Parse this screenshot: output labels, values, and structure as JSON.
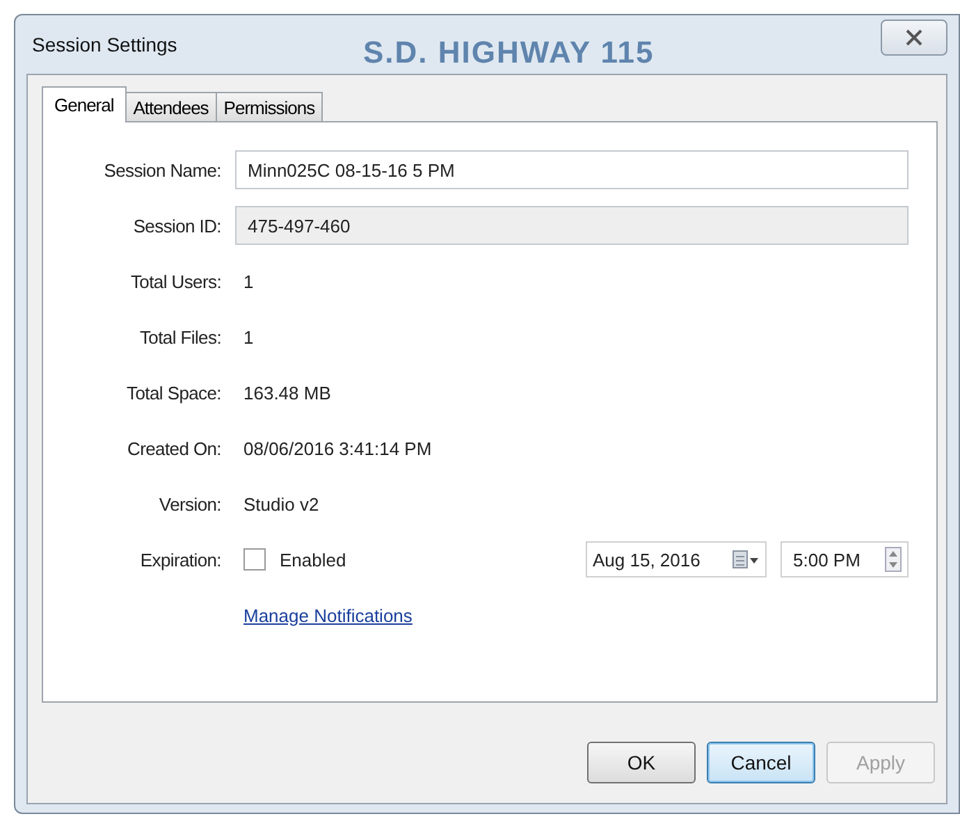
{
  "window": {
    "title": "Session Settings",
    "background_text": "S.D. HIGHWAY 115"
  },
  "tabs": [
    {
      "label": "General",
      "selected": true
    },
    {
      "label": "Attendees",
      "selected": false
    },
    {
      "label": "Permissions",
      "selected": false
    }
  ],
  "fields": [
    {
      "label": "Session Name:",
      "value": "Minn025C 08-15-16 5 PM",
      "kind": "input"
    },
    {
      "label": "Session ID:",
      "value": "475-497-460",
      "kind": "readonly"
    },
    {
      "label": "Total Users:",
      "value": "1",
      "kind": "text"
    },
    {
      "label": "Total Files:",
      "value": "1",
      "kind": "text"
    },
    {
      "label": "Total Space:",
      "value": "163.48 MB",
      "kind": "text"
    },
    {
      "label": "Created On:",
      "value": "08/06/2016 3:41:14 PM",
      "kind": "text"
    },
    {
      "label": "Version:",
      "value": "Studio v2",
      "kind": "text"
    }
  ],
  "expiration": {
    "label": "Expiration:",
    "checkbox_label": "Enabled",
    "checked": false,
    "date": "Aug 15, 2016",
    "time": "5:00 PM"
  },
  "link": "Manage Notifications",
  "buttons": [
    {
      "label": "OK",
      "focused": false,
      "disabled": false
    },
    {
      "label": "Cancel",
      "focused": true,
      "disabled": false
    },
    {
      "label": "Apply",
      "focused": false,
      "disabled": true
    }
  ]
}
